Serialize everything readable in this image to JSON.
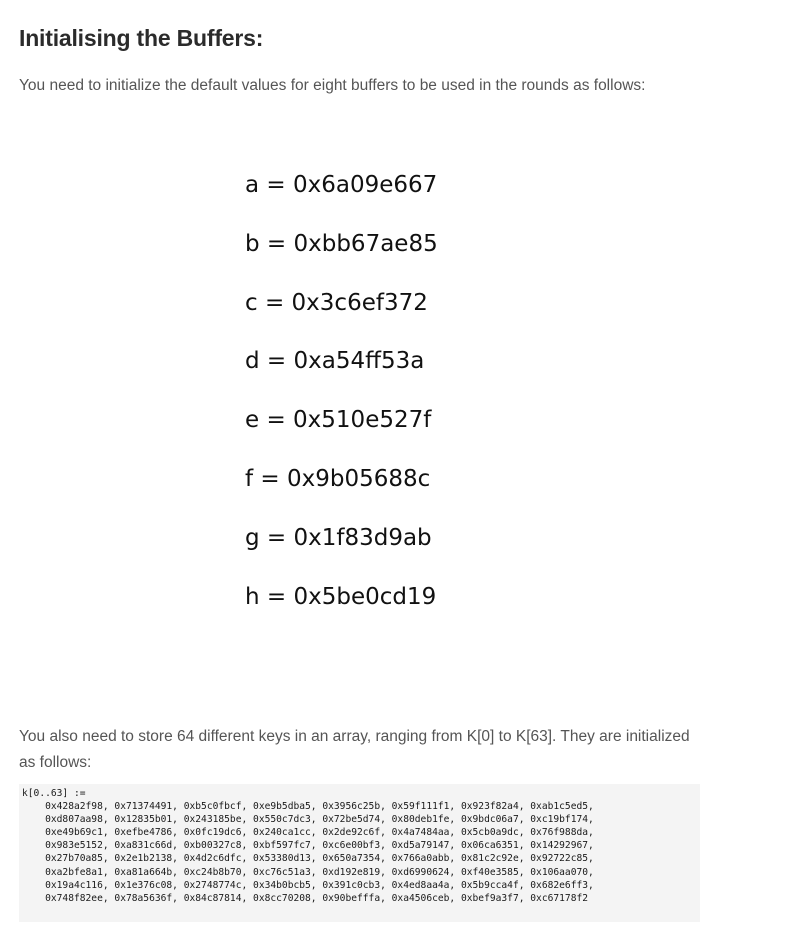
{
  "heading": "Initialising the Buffers:",
  "intro": "You need to initialize the default values for eight buffers to be used in the rounds as follows:",
  "buffers": [
    "a = 0x6a09e667",
    "b = 0xbb67ae85",
    "c = 0x3c6ef372",
    "d = 0xa54ff53a",
    "e = 0x510e527f",
    "f = 0x9b05688c",
    "g = 0x1f83d9ab",
    "h = 0x5be0cd19"
  ],
  "keys_text": "You also need to store 64 different keys in an array, ranging from K[0] to K[63]. They are initialized as follows:",
  "code_lines": [
    "k[0..63] :=",
    "    0x428a2f98, 0x71374491, 0xb5c0fbcf, 0xe9b5dba5, 0x3956c25b, 0x59f111f1, 0x923f82a4, 0xab1c5ed5,",
    "    0xd807aa98, 0x12835b01, 0x243185be, 0x550c7dc3, 0x72be5d74, 0x80deb1fe, 0x9bdc06a7, 0xc19bf174,",
    "    0xe49b69c1, 0xefbe4786, 0x0fc19dc6, 0x240ca1cc, 0x2de92c6f, 0x4a7484aa, 0x5cb0a9dc, 0x76f988da,",
    "    0x983e5152, 0xa831c66d, 0xb00327c8, 0xbf597fc7, 0xc6e00bf3, 0xd5a79147, 0x06ca6351, 0x14292967,",
    "    0x27b70a85, 0x2e1b2138, 0x4d2c6dfc, 0x53380d13, 0x650a7354, 0x766a0abb, 0x81c2c92e, 0x92722c85,",
    "    0xa2bfe8a1, 0xa81a664b, 0xc24b8b70, 0xc76c51a3, 0xd192e819, 0xd6990624, 0xf40e3585, 0x106aa070,",
    "    0x19a4c116, 0x1e376c08, 0x2748774c, 0x34b0bcb5, 0x391c0cb3, 0x4ed8aa4a, 0x5b9cca4f, 0x682e6ff3,",
    "    0x748f82ee, 0x78a5636f, 0x84c87814, 0x8cc70208, 0x90befffa, 0xa4506ceb, 0xbef9a3f7, 0xc67178f2"
  ]
}
